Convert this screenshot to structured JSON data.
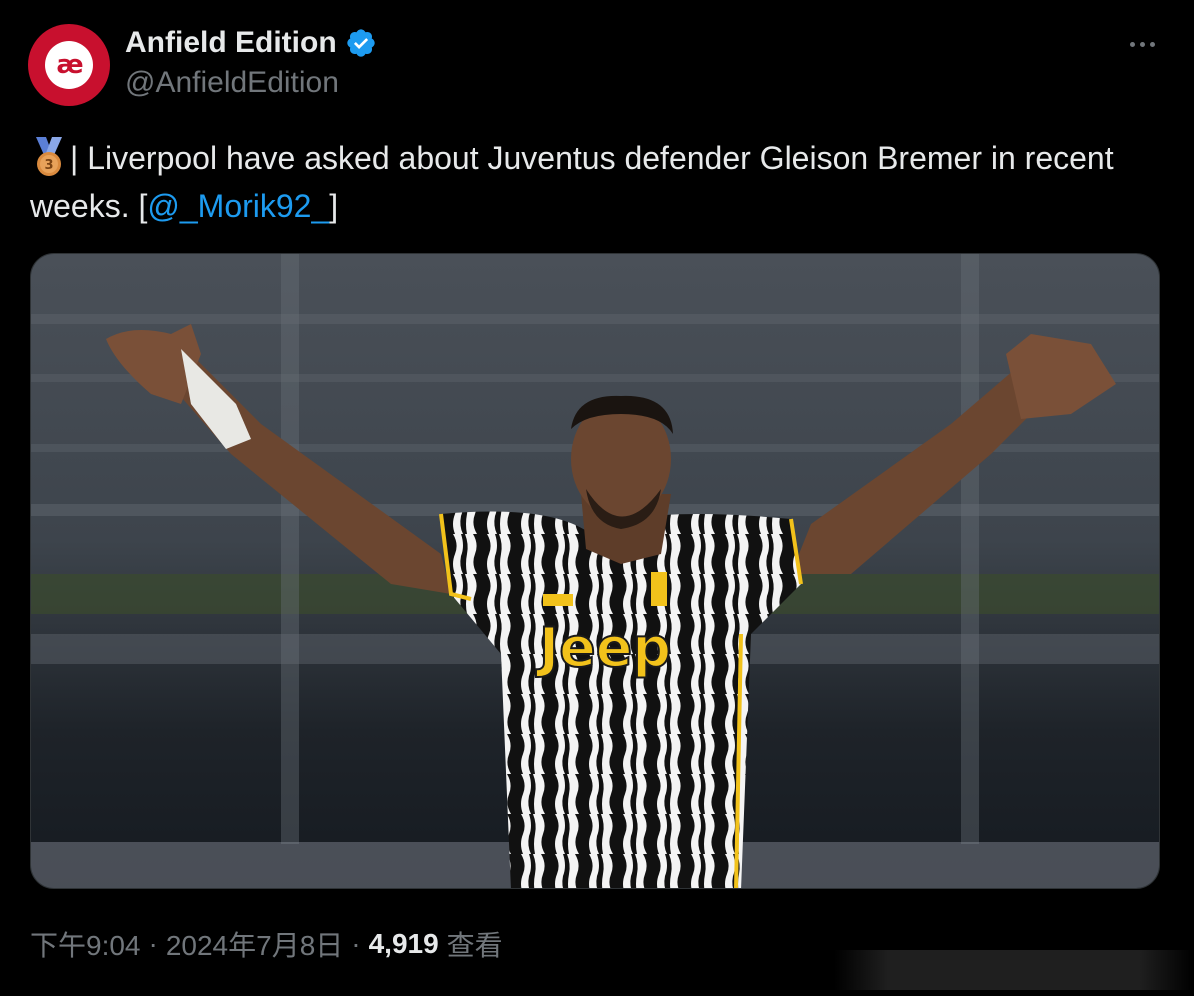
{
  "author": {
    "name": "Anfield Edition",
    "handle": "@AnfieldEdition",
    "avatar_text": "æ",
    "verified": true
  },
  "tweet": {
    "text_before": "| Liverpool have asked about Juventus defender Gleison Bremer in recent weeks. [",
    "mention": "@_Morik92_",
    "text_after": "]",
    "medal_number": "3"
  },
  "media": {
    "description": "Footballer in black-and-white striped Juventus jersey with Jeep sponsor, arms outstretched",
    "sponsor_text": "Jeep"
  },
  "meta": {
    "time": "下午9:04",
    "date": "2024年7月8日",
    "views": "4,919",
    "views_label": "查看"
  },
  "colors": {
    "background": "#000000",
    "text": "#e7e9ea",
    "secondary": "#71767b",
    "link": "#1d9bf0",
    "verified": "#1d9bf0",
    "avatar": "#c8102e"
  }
}
